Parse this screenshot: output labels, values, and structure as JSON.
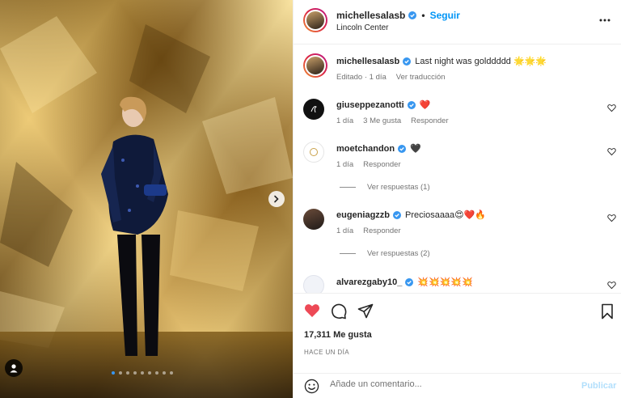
{
  "post": {
    "author": "michellesalasb",
    "follow_label": "Seguir",
    "bullet": "•",
    "location": "Lincoln Center",
    "caption_author": "michellesalasb",
    "caption_text": "Last night was golddddd 🌟🌟🌟",
    "caption_edited": "Editado · 1 día",
    "caption_translate": "Ver traducción"
  },
  "comments": [
    {
      "user": "giuseppezanotti",
      "text": "❤️",
      "time": "1 día",
      "likes": "3 Me gusta",
      "reply": "Responder"
    },
    {
      "user": "moetchandon",
      "text": "🖤",
      "time": "1 día",
      "reply": "Responder",
      "view_replies": "Ver respuestas (1)"
    },
    {
      "user": "eugeniagzzb",
      "text": "Preciosaaaa😍❤️🔥",
      "time": "1 día",
      "reply": "Responder",
      "view_replies": "Ver respuestas (2)"
    },
    {
      "user": "alvarezgaby10_",
      "text": "💥💥💥💥💥"
    }
  ],
  "stats": {
    "likes": "17,311 Me gusta",
    "ago": "HACE UN DÍA"
  },
  "composer": {
    "placeholder": "Añade un comentario...",
    "publish": "Publicar"
  },
  "carousel": {
    "slides": 9,
    "active_index": 0
  },
  "colors": {
    "accent": "#0095f6",
    "like_red": "#ed4956",
    "verified": "#3897f0"
  },
  "icons": [
    "chevron-right-icon",
    "user-tag-icon",
    "more-icon",
    "heart-icon",
    "comment-icon",
    "share-icon",
    "bookmark-icon",
    "emoji-icon",
    "verified-icon"
  ]
}
